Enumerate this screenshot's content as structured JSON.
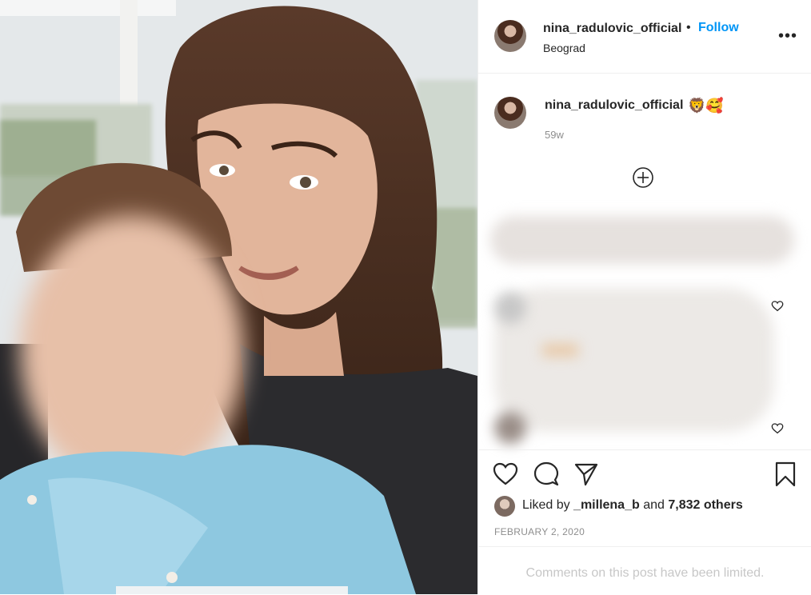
{
  "post": {
    "username": "nina_radulovic_official",
    "separator": "•",
    "follow_label": "Follow",
    "location": "Beograd",
    "more_icon": "•••"
  },
  "caption": {
    "username": "nina_radulovic_official",
    "emoji": "🦁🥰",
    "time_ago": "59w"
  },
  "likes": {
    "prefix": "Liked by ",
    "liker": "_millena_b",
    "middle": " and ",
    "count": "7,832 others"
  },
  "date": "FEBRUARY 2, 2020",
  "comments_limited": "Comments on this post have been limited.",
  "icons": [
    "heart-icon",
    "comment-icon",
    "share-icon",
    "bookmark-icon",
    "more-icon",
    "add-comment-icon"
  ],
  "colors": {
    "accent": "#0095f6",
    "text": "#262626",
    "muted": "#8e8e8e"
  }
}
